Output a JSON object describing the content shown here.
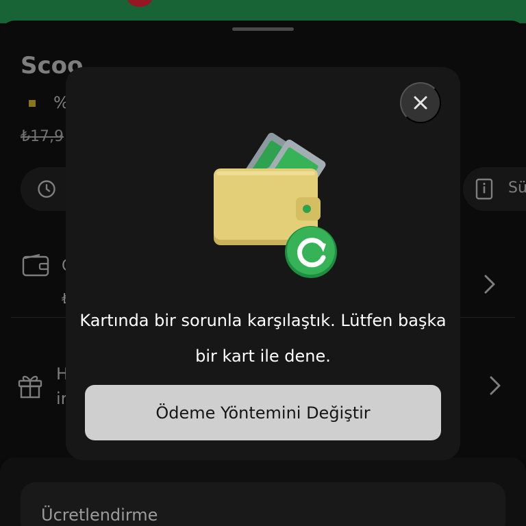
{
  "background": {
    "store": {
      "title": "Scoo",
      "discount": "%",
      "old_price": "₺17,9"
    },
    "chips": {
      "left_label": "",
      "right_label": "Sü"
    },
    "wallet_row": {
      "line1": "C",
      "line2": "₺"
    },
    "gift_row": {
      "line1": "H",
      "line2": "ir"
    },
    "pricing": {
      "label": "Ücretlendirme"
    }
  },
  "modal": {
    "close_icon": "close-icon",
    "illustration_icon": "wallet-refresh-icon",
    "message": "Kartında bir sorunla karşılaştık. Lütfen başka bir kart ile dene.",
    "cta_label": "Ödeme Yöntemini Değiştir"
  },
  "colors": {
    "top_bar": "#1f7a43",
    "modal_bg": "#171717",
    "cta_bg": "#cfcfcf",
    "accent_green": "#2ea84e",
    "wallet_yellow": "#e3cf78"
  }
}
